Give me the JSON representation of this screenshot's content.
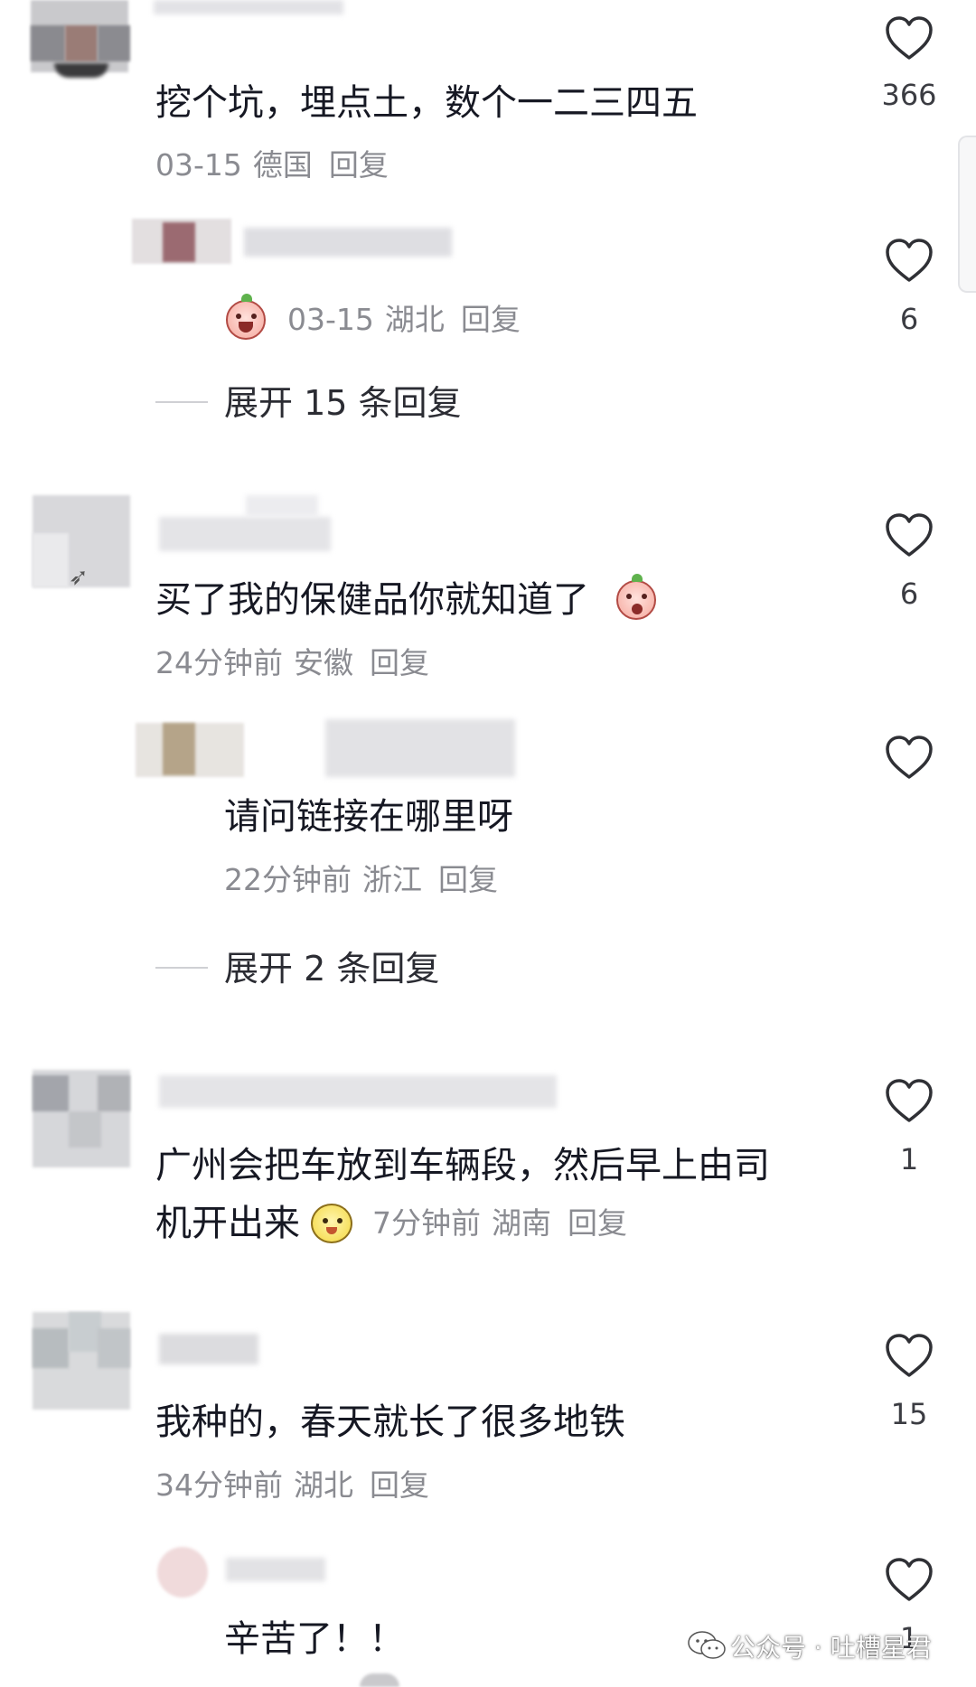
{
  "comments": [
    {
      "text": "挖个坑，埋点土，数个一二三四五",
      "date": "03-15",
      "location": "德国",
      "reply": "回复",
      "likes": "366"
    },
    {
      "date": "03-15",
      "location": "湖北",
      "reply": "回复",
      "likes": "6",
      "emoji": "grinning-peach-emoji"
    },
    {
      "text": "买了我的保健品你就知道了",
      "date": "24分钟前",
      "location": "安徽",
      "reply": "回复",
      "likes": "6",
      "emoji": "surprised-peach-emoji"
    },
    {
      "text": "请问链接在哪里呀",
      "date": "22分钟前",
      "location": "浙江",
      "reply": "回复"
    },
    {
      "text_line1": "广州会把车放到车辆段，然后早上由司",
      "text_line2": "机开出来",
      "date": "7分钟前",
      "location": "湖南",
      "reply": "回复",
      "likes": "1",
      "emoji": "yellow-cat-emoji"
    },
    {
      "text": "我种的，春天就长了很多地铁",
      "date": "34分钟前",
      "location": "湖北",
      "reply": "回复",
      "likes": "15"
    },
    {
      "text": "辛苦了！！",
      "likes": "1"
    }
  ],
  "expand_replies": [
    "展开 15 条回复",
    "展开 2 条回复"
  ],
  "watermark": "公众号 · 吐槽星君",
  "colors": {
    "text": "#161823",
    "meta": "#8a8b91",
    "icon": "#2f3035"
  }
}
